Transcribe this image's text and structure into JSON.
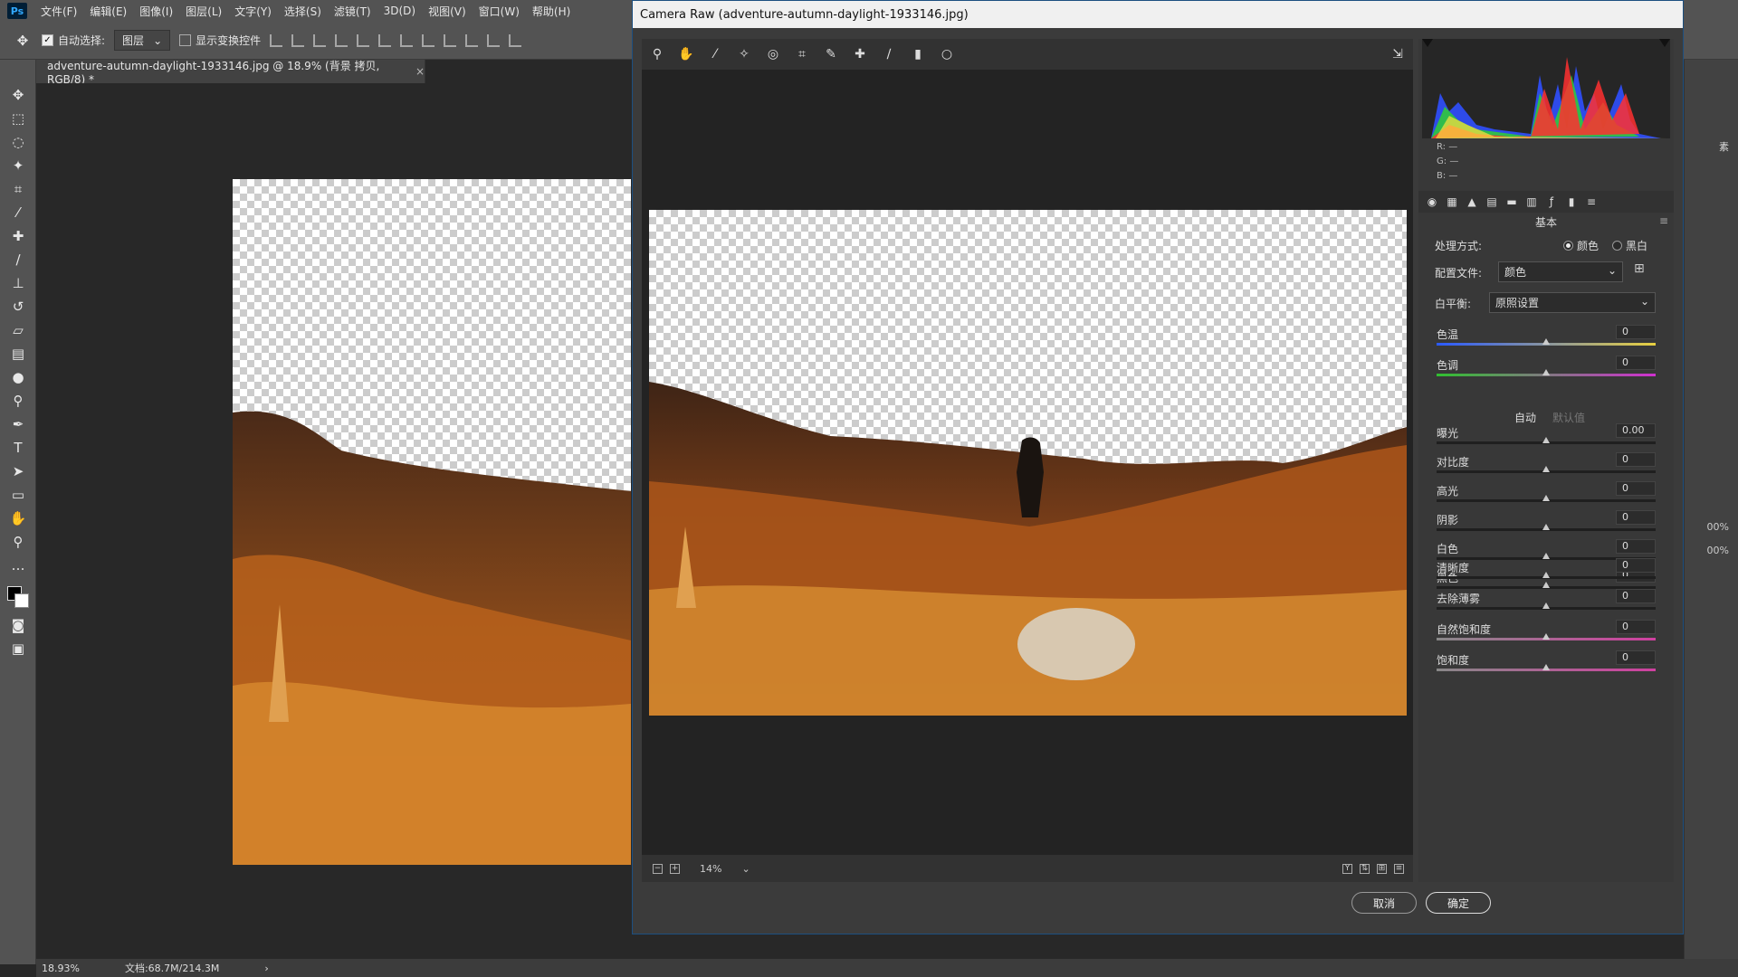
{
  "menubar": {
    "app_icon": "Ps",
    "items": [
      "文件(F)",
      "编辑(E)",
      "图像(I)",
      "图层(L)",
      "文字(Y)",
      "选择(S)",
      "滤镜(T)",
      "3D(D)",
      "视图(V)",
      "窗口(W)",
      "帮助(H)"
    ]
  },
  "options": {
    "auto_select_label": "自动选择:",
    "auto_select_value": "图层",
    "show_transform_label": "显示变换控件"
  },
  "document": {
    "tab_title": "adventure-autumn-daylight-1933146.jpg @ 18.9% (背景 拷贝, RGB/8) *",
    "close": "×"
  },
  "status": {
    "zoom": "18.93%",
    "doc_size": "文档:68.7M/214.3M",
    "arrow": "›"
  },
  "right_strip": {
    "pct1": "00%",
    "pct2": "00%",
    "label": "素"
  },
  "camera_raw": {
    "title": "Camera Raw (adventure-autumn-daylight-1933146.jpg)",
    "zoom": "14%",
    "histogram_rgb": {
      "r": "R:",
      "g": "G:",
      "b": "B:",
      "r_val": "—",
      "g_val": "—",
      "b_val": "—"
    },
    "section_title": "基本",
    "treatment": {
      "label": "处理方式:",
      "color": "颜色",
      "bw": "黑白",
      "selected": "color"
    },
    "profile": {
      "label": "配置文件:",
      "value": "颜色"
    },
    "white_balance": {
      "label": "白平衡:",
      "value": "原照设置"
    },
    "sliders_wb": [
      {
        "label": "色温",
        "value": "0",
        "pos": 0.5
      },
      {
        "label": "色调",
        "value": "0",
        "pos": 0.5
      }
    ],
    "auto_label": "自动",
    "default_label": "默认值",
    "sliders_tone": [
      {
        "label": "曝光",
        "value": "0.00",
        "pos": 0.5
      },
      {
        "label": "对比度",
        "value": "0",
        "pos": 0.5
      },
      {
        "label": "高光",
        "value": "0",
        "pos": 0.5
      },
      {
        "label": "阴影",
        "value": "0",
        "pos": 0.5
      },
      {
        "label": "白色",
        "value": "0",
        "pos": 0.5
      },
      {
        "label": "黑色",
        "value": "0",
        "pos": 0.5
      }
    ],
    "sliders_presence": [
      {
        "label": "清晰度",
        "value": "0",
        "pos": 0.5
      },
      {
        "label": "去除薄雾",
        "value": "0",
        "pos": 0.5
      },
      {
        "label": "自然饱和度",
        "value": "0",
        "pos": 0.5
      },
      {
        "label": "饱和度",
        "value": "0",
        "pos": 0.5
      }
    ],
    "cancel": "取消",
    "ok": "确定"
  }
}
